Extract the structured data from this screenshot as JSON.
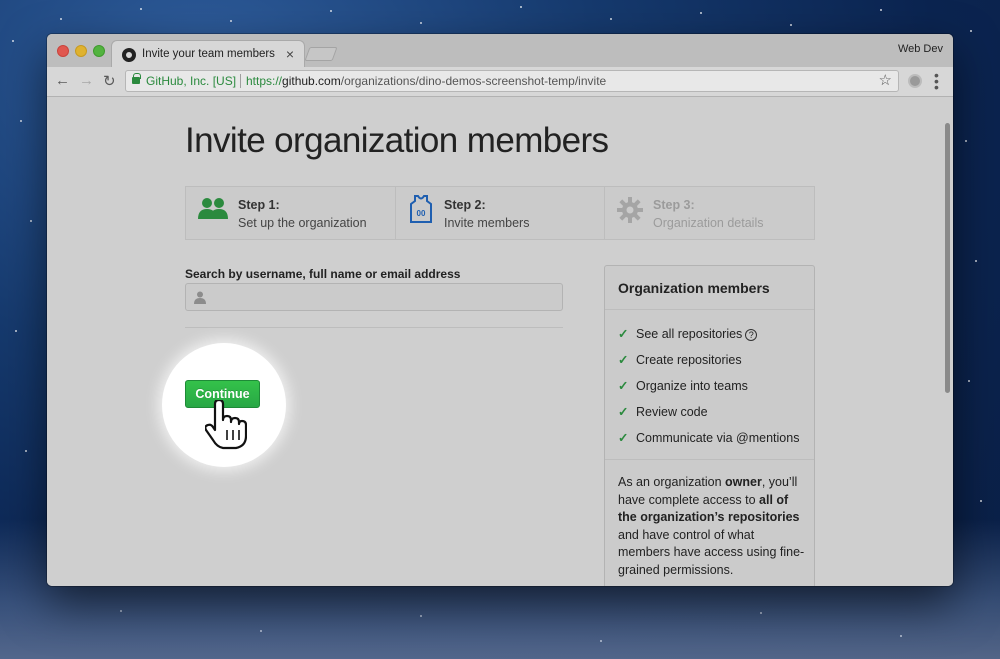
{
  "browser": {
    "tab_title": "Invite your team members",
    "tab_close": "×",
    "profile_name": "Web Dev",
    "ev_label": "GitHub, Inc. [US]",
    "url_scheme": "https://",
    "url_host": "github.com",
    "url_path": "/organizations/dino-demos-screenshot-temp/invite"
  },
  "page": {
    "title": "Invite organization members",
    "steps": [
      {
        "num": "Step 1:",
        "desc": "Set up the organization",
        "icon": "people-icon",
        "state": "done"
      },
      {
        "num": "Step 2:",
        "desc": "Invite members",
        "icon": "jersey-icon",
        "state": "active"
      },
      {
        "num": "Step 3:",
        "desc": "Organization details",
        "icon": "gear-icon",
        "state": "disabled"
      }
    ],
    "search_label": "Search by username, full name or email address",
    "search_value": "",
    "continue_label": "Continue"
  },
  "panel": {
    "title": "Organization members",
    "permissions": [
      "See all repositories",
      "Create repositories",
      "Organize into teams",
      "Review code",
      "Communicate via @mentions"
    ],
    "help_icon": "?",
    "note_parts": {
      "a": "As an organization ",
      "b": "owner",
      "c": ", you’ll have complete access to ",
      "d": "all of the organization’s repositories",
      "e": " and have control of what members have access using fine-grained permissions."
    }
  },
  "colors": {
    "accent_green": "#28a745",
    "check_green": "#2b8a3e"
  }
}
